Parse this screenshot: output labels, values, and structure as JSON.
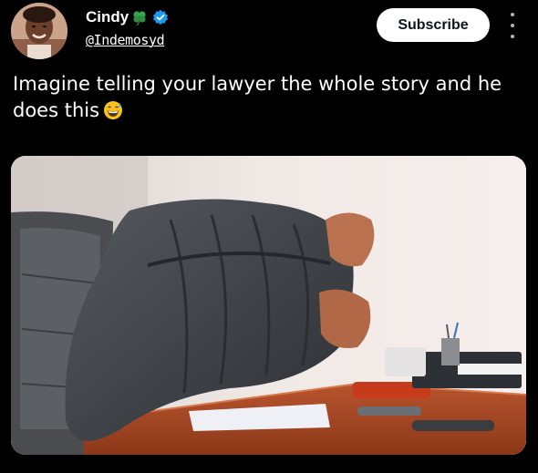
{
  "tweet": {
    "author": {
      "display_name": "Cindy",
      "handle": "@Indemosyd",
      "badge_icon": "clover-icon",
      "verified_icon": "verified-badge-icon",
      "verified_color": "#1d9bf0"
    },
    "actions": {
      "subscribe_label": "Subscribe",
      "more_icon": "more-vertical-icon"
    },
    "text": "Imagine telling your lawyer the whole story and he does this",
    "text_emoji": "grinning-sweat-emoji",
    "media": {
      "type": "photo"
    }
  },
  "colors": {
    "background": "#000000",
    "text": "#ffffff",
    "subscribe_bg": "#ffffff",
    "subscribe_text": "#0f1419"
  }
}
